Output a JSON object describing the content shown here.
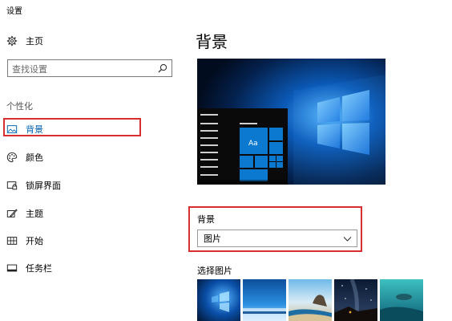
{
  "window": {
    "title": "设置"
  },
  "sidebar": {
    "home_label": "主页",
    "search_placeholder": "查找设置",
    "section_label": "个性化",
    "items": [
      {
        "label": "背景",
        "icon": "picture-icon",
        "active": true
      },
      {
        "label": "颜色",
        "icon": "palette-icon"
      },
      {
        "label": "锁屏界面",
        "icon": "lock-screen-icon"
      },
      {
        "label": "主题",
        "icon": "theme-brush-icon"
      },
      {
        "label": "开始",
        "icon": "start-grid-icon"
      },
      {
        "label": "任务栏",
        "icon": "taskbar-icon"
      }
    ]
  },
  "main": {
    "title": "背景",
    "preview_tile_label": "Aa",
    "background_label": "背景",
    "background_value": "图片",
    "choose_picture_label": "选择图片"
  },
  "colors": {
    "accent": "#0063b1",
    "highlight_border": "#d92e2e",
    "tile_blue": "#0b79d0"
  }
}
